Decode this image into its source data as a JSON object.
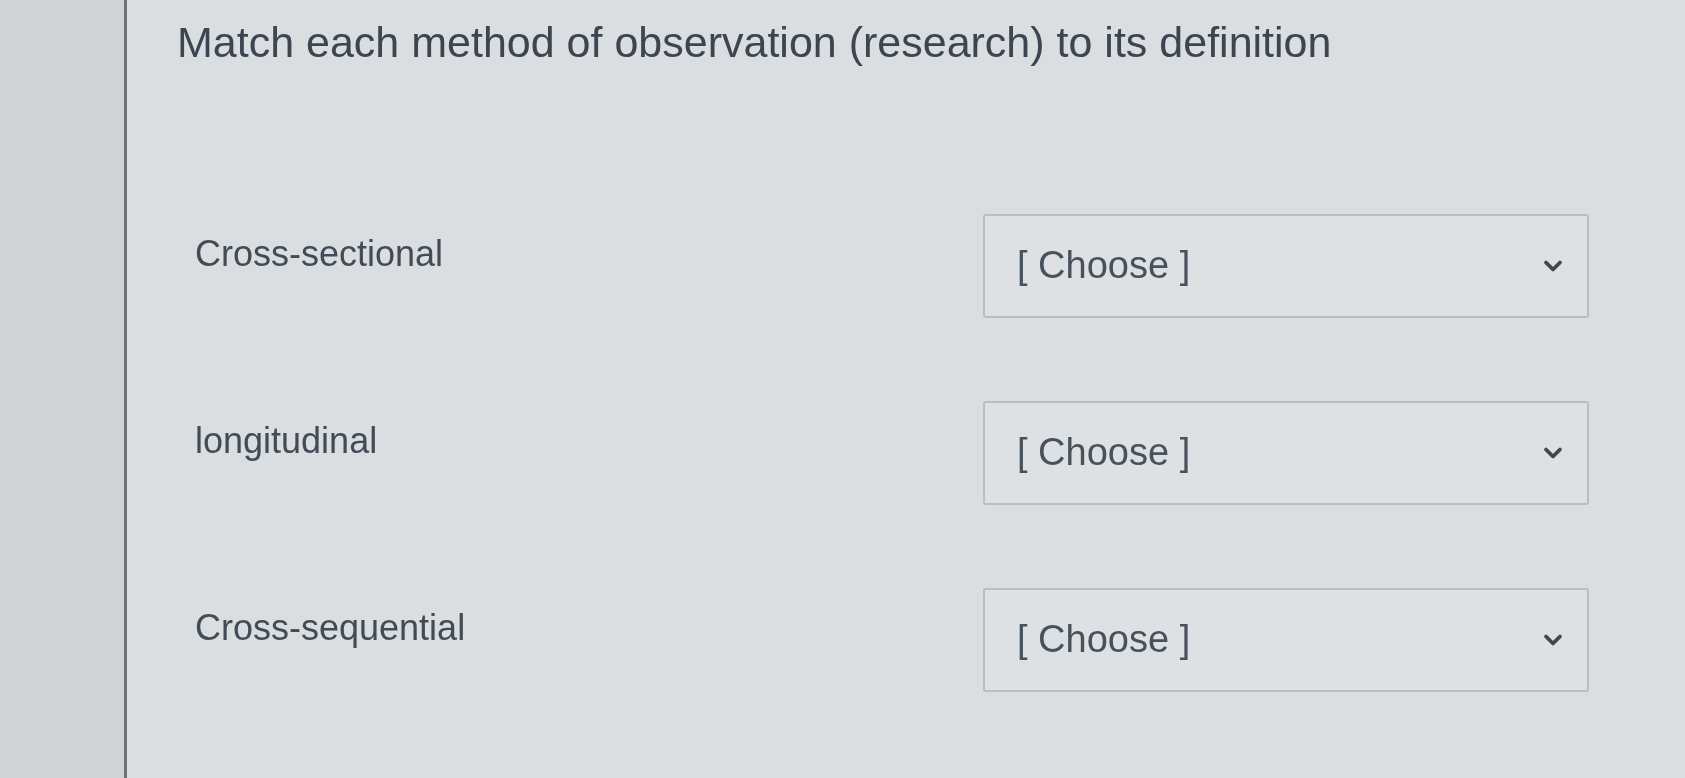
{
  "question": {
    "title": "Match each method of observation (research) to its definition"
  },
  "matches": [
    {
      "term": "Cross-sectional",
      "dropdown": {
        "value": "[ Choose ]"
      }
    },
    {
      "term": "longitudinal",
      "dropdown": {
        "value": "[ Choose ]"
      }
    },
    {
      "term": "Cross-sequential",
      "dropdown": {
        "value": "[ Choose ]"
      }
    }
  ]
}
